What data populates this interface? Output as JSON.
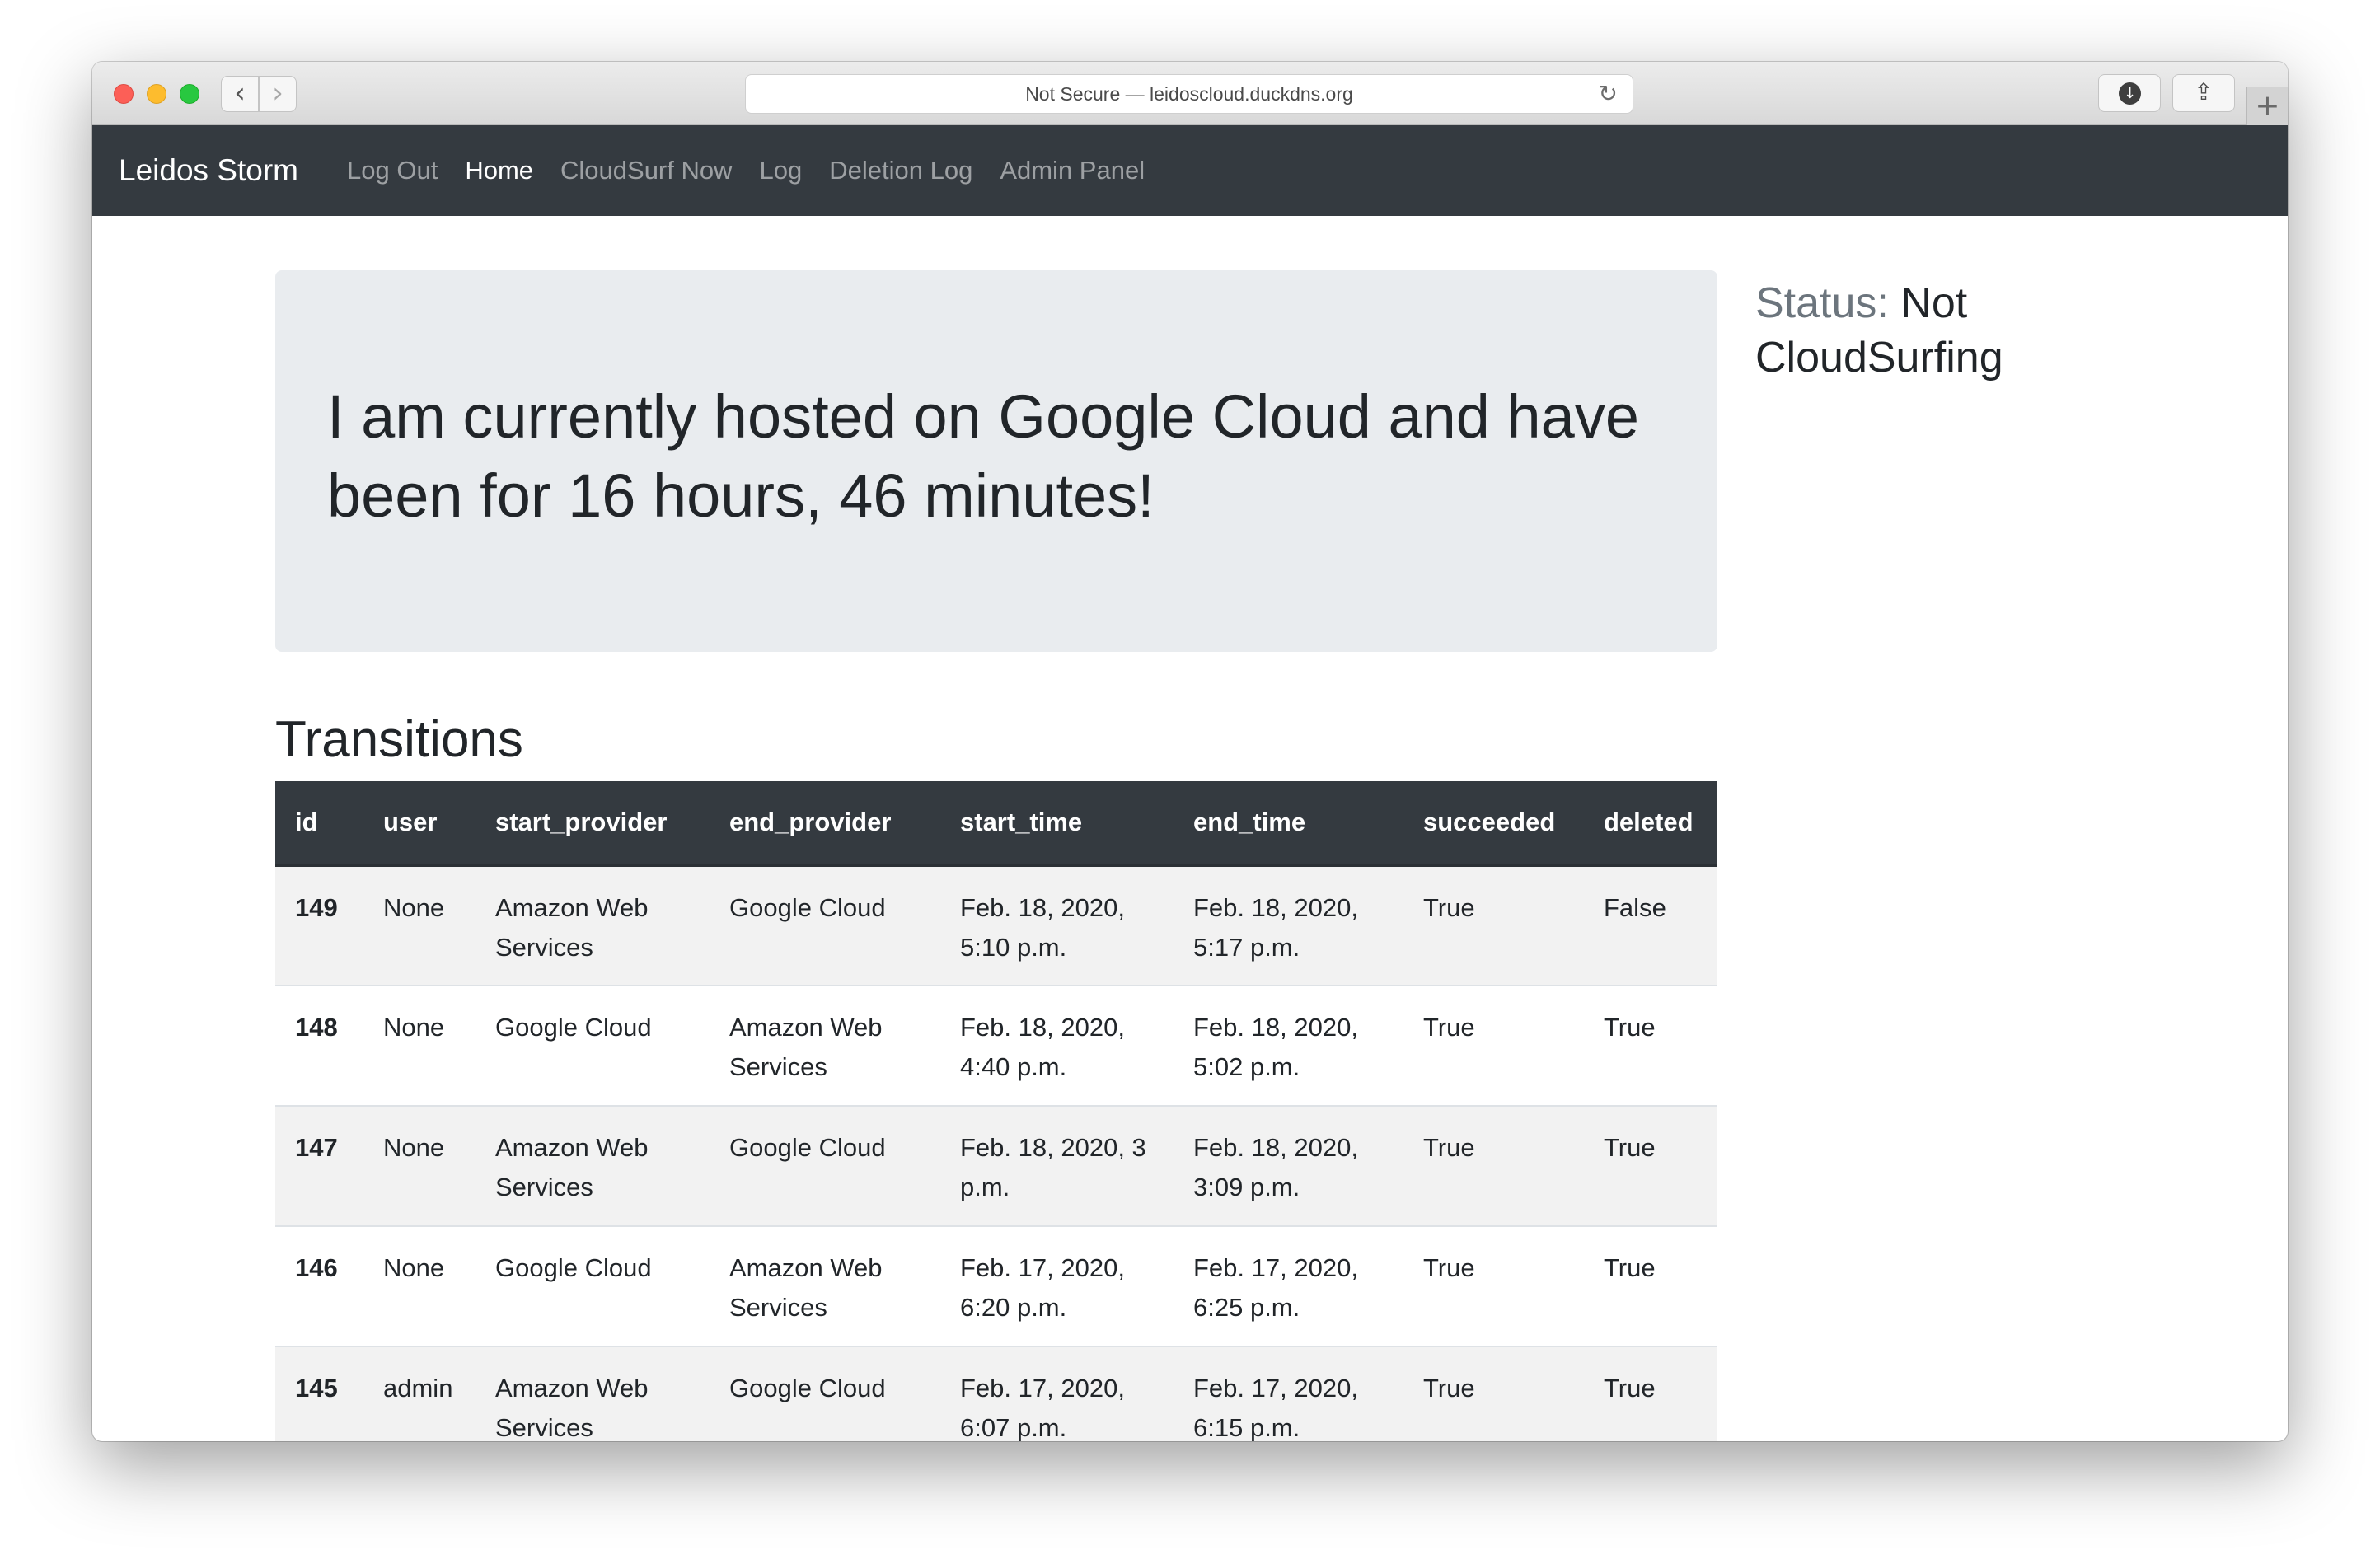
{
  "browser": {
    "url_text": "Not Secure — leidoscloud.duckdns.org",
    "back_glyph": "‹",
    "forward_glyph": "›",
    "reload_glyph": "↻",
    "download_glyph": "↓",
    "share_glyph": "⇪",
    "newtab_glyph": "+"
  },
  "navbar": {
    "brand": "Leidos Storm",
    "links": [
      {
        "label": "Log Out",
        "active": false
      },
      {
        "label": "Home",
        "active": true
      },
      {
        "label": "CloudSurf Now",
        "active": false
      },
      {
        "label": "Log",
        "active": false
      },
      {
        "label": "Deletion Log",
        "active": false
      },
      {
        "label": "Admin Panel",
        "active": false
      }
    ]
  },
  "jumbotron": {
    "message": "I am currently hosted on Google Cloud and have been for 16 hours, 46 minutes!"
  },
  "status": {
    "label": "Status:",
    "value": "Not CloudSurfing"
  },
  "transitions": {
    "title": "Transitions",
    "columns": [
      "id",
      "user",
      "start_provider",
      "end_provider",
      "start_time",
      "end_time",
      "succeeded",
      "deleted"
    ],
    "rows": [
      {
        "id": "149",
        "user": "None",
        "start_provider": "Amazon Web Services",
        "end_provider": "Google Cloud",
        "start_time": "Feb. 18, 2020, 5:10 p.m.",
        "end_time": "Feb. 18, 2020, 5:17 p.m.",
        "succeeded": "True",
        "deleted": "False"
      },
      {
        "id": "148",
        "user": "None",
        "start_provider": "Google Cloud",
        "end_provider": "Amazon Web Services",
        "start_time": "Feb. 18, 2020, 4:40 p.m.",
        "end_time": "Feb. 18, 2020, 5:02 p.m.",
        "succeeded": "True",
        "deleted": "True"
      },
      {
        "id": "147",
        "user": "None",
        "start_provider": "Amazon Web Services",
        "end_provider": "Google Cloud",
        "start_time": "Feb. 18, 2020, 3 p.m.",
        "end_time": "Feb. 18, 2020, 3:09 p.m.",
        "succeeded": "True",
        "deleted": "True"
      },
      {
        "id": "146",
        "user": "None",
        "start_provider": "Google Cloud",
        "end_provider": "Amazon Web Services",
        "start_time": "Feb. 17, 2020, 6:20 p.m.",
        "end_time": "Feb. 17, 2020, 6:25 p.m.",
        "succeeded": "True",
        "deleted": "True"
      },
      {
        "id": "145",
        "user": "admin",
        "start_provider": "Amazon Web Services",
        "end_provider": "Google Cloud",
        "start_time": "Feb. 17, 2020, 6:07 p.m.",
        "end_time": "Feb. 17, 2020, 6:15 p.m.",
        "succeeded": "True",
        "deleted": "True"
      }
    ]
  },
  "colors": {
    "navbar_bg": "#343a40",
    "jumbotron_bg": "#e9ecef",
    "text": "#212529",
    "muted": "#6c757d",
    "stripe": "#f2f2f2"
  }
}
